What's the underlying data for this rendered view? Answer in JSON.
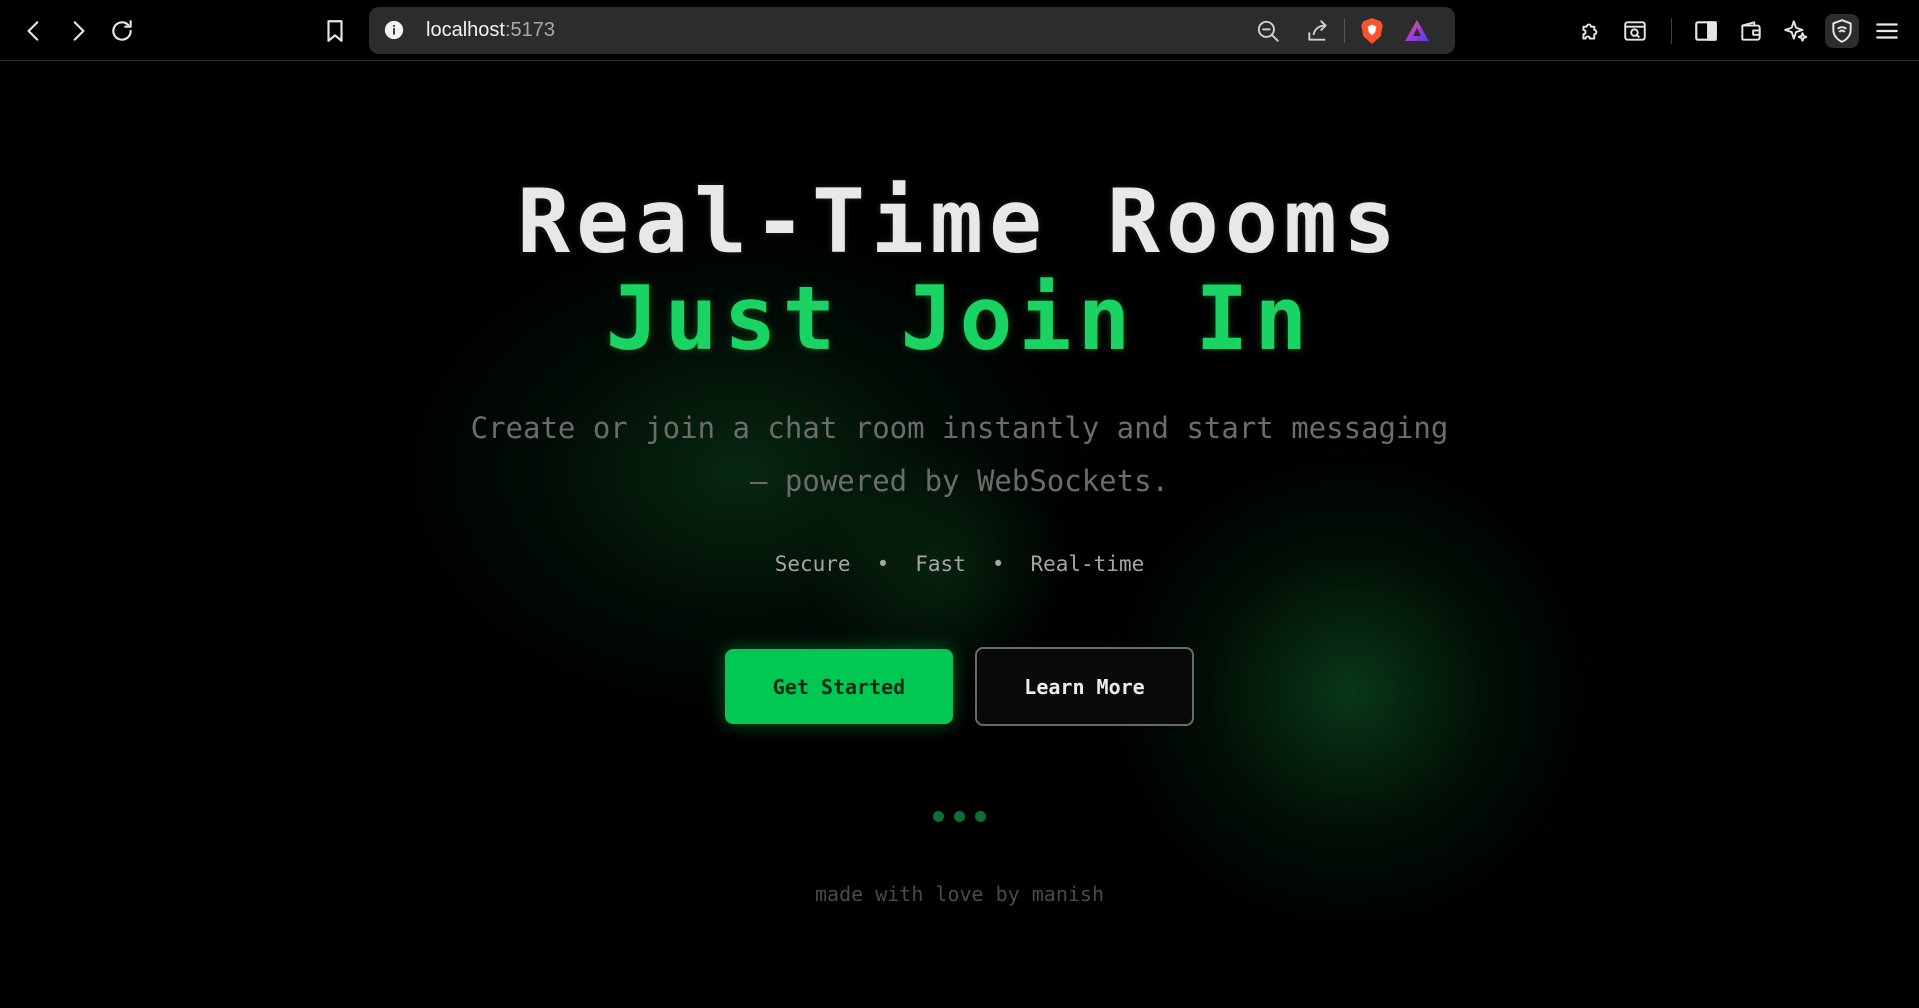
{
  "browser": {
    "url_host": "localhost",
    "url_port": ":5173"
  },
  "hero": {
    "title_line1": "Real-Time Rooms",
    "title_line2": "Just Join In",
    "subtitle": "Create or join a chat room instantly and start messaging — powered by WebSockets.",
    "features": [
      "Secure",
      "Fast",
      "Real-time"
    ],
    "feature_separator": "•",
    "primary_button": "Get Started",
    "secondary_button": "Learn More"
  },
  "footer": {
    "text": "made with love by manish"
  },
  "colors": {
    "accent": "#00c853",
    "accent_text": "#19d463",
    "background": "#000000"
  },
  "icons": {
    "back": "chevron-left-icon",
    "forward": "chevron-right-icon",
    "reload": "reload-icon",
    "bookmark": "bookmark-icon",
    "info": "info-icon",
    "zoom": "zoom-out-icon",
    "share": "share-icon",
    "brave": "brave-shield-icon",
    "rewards": "brave-rewards-icon",
    "extensions": "puzzle-icon",
    "tab_search": "tab-search-icon",
    "sidebar": "sidebar-icon",
    "wallet": "wallet-icon",
    "leo": "sparkle-icon",
    "vpn": "vpn-shield-icon",
    "menu": "hamburger-menu-icon"
  }
}
